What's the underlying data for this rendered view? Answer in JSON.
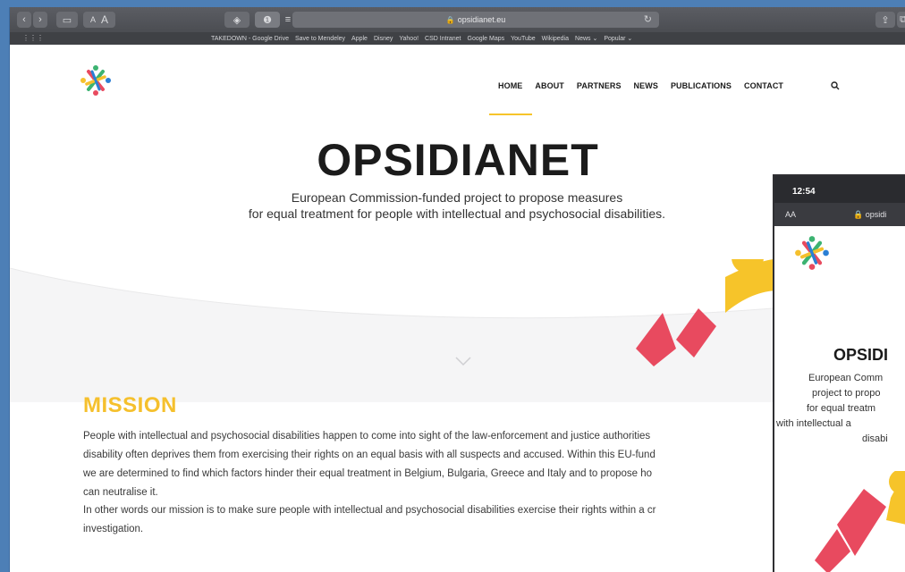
{
  "browser": {
    "url": "opsidianet.eu",
    "toolbar_buttons": {
      "text_small": "A",
      "text_large": "A"
    },
    "bookmarks": [
      "TAKEDOWN - Google Drive",
      "Save to Mendeley",
      "Apple",
      "Disney",
      "Yahoo!",
      "CSD Intranet",
      "Google Maps",
      "YouTube",
      "Wikipedia",
      "News ⌄",
      "Popular ⌄"
    ]
  },
  "site": {
    "nav": [
      "HOME",
      "ABOUT",
      "PARTNERS",
      "NEWS",
      "PUBLICATIONS",
      "CONTACT"
    ],
    "title": "OPSIDIANET",
    "subtitle_line1": "European Commission-funded project to propose measures",
    "subtitle_line2": "for equal treatment for people with intellectual and psychosocial disabilities.",
    "mission_heading": "MISSION",
    "mission_p1_l1": "People with intellectual and psychosocial disabilities happen to come into sight of the law-enforcement and justice authorities",
    "mission_p1_l2": "disability often deprives them from exercising their rights on an equal basis with all suspects and accused. Within this EU-fund",
    "mission_p1_l3": "we are determined to find which factors hinder their equal treatment in Belgium, Bulgaria, Greece and Italy and to propose ho",
    "mission_p1_l4": "can neutralise it.",
    "mission_p2_l1": "In other words our mission is to make sure people with intellectual and psychosocial disabilities exercise their rights within a cr",
    "mission_p2_l2": "investigation."
  },
  "phone": {
    "time": "12:54",
    "aa": "AA",
    "url": "opsidi",
    "title": "OPSIDI",
    "sub": [
      "European Comm",
      "project to propo",
      "for equal treatm",
      "with intellectual a",
      "disabi"
    ]
  },
  "colors": {
    "accent_yellow": "#f5c02d",
    "accent_red": "#e84a5f",
    "chrome": "#4b4d52"
  }
}
